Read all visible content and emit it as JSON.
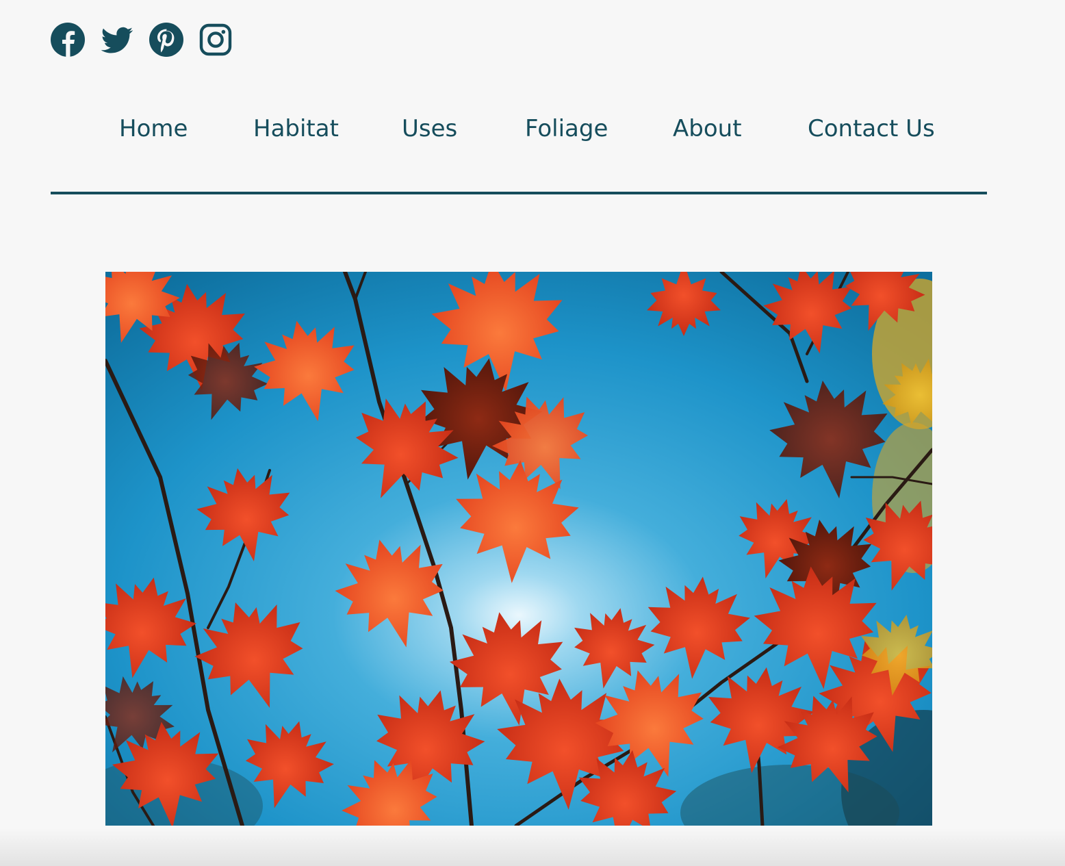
{
  "colors": {
    "accent": "#164d5c",
    "page_background": "#f7f7f7"
  },
  "social": [
    {
      "icon": "facebook-icon"
    },
    {
      "icon": "twitter-icon"
    },
    {
      "icon": "pinterest-icon"
    },
    {
      "icon": "instagram-icon"
    }
  ],
  "nav": {
    "items": [
      {
        "label": "Home"
      },
      {
        "label": "Habitat"
      },
      {
        "label": "Uses"
      },
      {
        "label": "Foliage"
      },
      {
        "label": "About"
      },
      {
        "label": "Contact Us"
      }
    ]
  },
  "hero": {
    "subject": "red maple leaves against blue sky"
  }
}
